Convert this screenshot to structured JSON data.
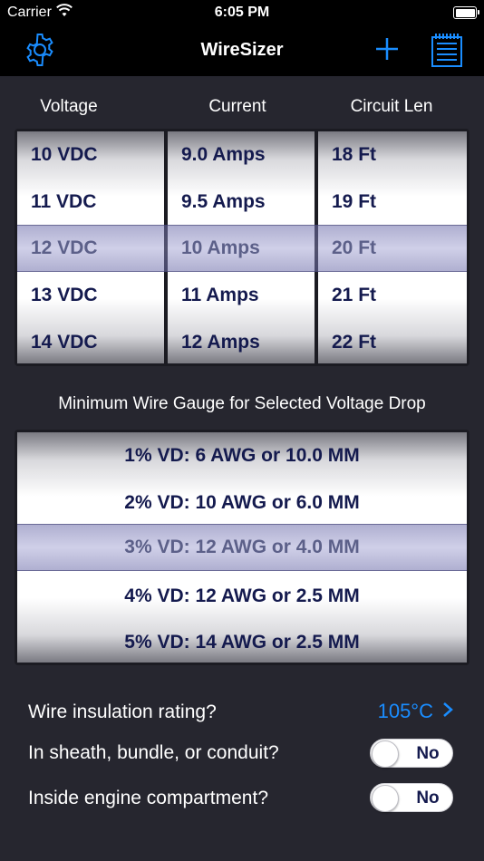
{
  "status_bar": {
    "carrier": "Carrier",
    "time": "6:05 PM"
  },
  "nav": {
    "title": "WireSizer",
    "left_icon": "gear-icon",
    "right_icons": [
      "plus-icon",
      "notepad-icon"
    ],
    "accent": "#1a8dff"
  },
  "picker": {
    "headers": [
      "Voltage",
      "Current",
      "Circuit Len"
    ],
    "voltage": [
      "10 VDC",
      "11 VDC",
      "12 VDC",
      "13 VDC",
      "14 VDC"
    ],
    "current": [
      "9.0 Amps",
      "9.5 Amps",
      "10 Amps",
      "11 Amps",
      "12 Amps"
    ],
    "length": [
      "18 Ft",
      "19 Ft",
      "20 Ft",
      "21 Ft",
      "22 Ft"
    ],
    "selected": {
      "voltage": "12 VDC",
      "current": "10 Amps",
      "length": "20 Ft"
    }
  },
  "gauge": {
    "caption": "Minimum Wire Gauge for Selected Voltage Drop",
    "rows": [
      "1% VD: 6 AWG or 10.0 MM",
      "2% VD: 10 AWG or 6.0 MM",
      "3% VD: 12 AWG or 4.0 MM",
      "4% VD: 12 AWG or 2.5 MM",
      "5% VD: 14 AWG or 2.5 MM"
    ],
    "selected": "3% VD: 12 AWG or 4.0 MM"
  },
  "settings": {
    "insulation_label": "Wire insulation rating?",
    "insulation_value": "105°C",
    "sheath_label": "In sheath, bundle, or conduit?",
    "sheath_value": "No",
    "engine_label": "Inside engine compartment?",
    "engine_value": "No"
  }
}
